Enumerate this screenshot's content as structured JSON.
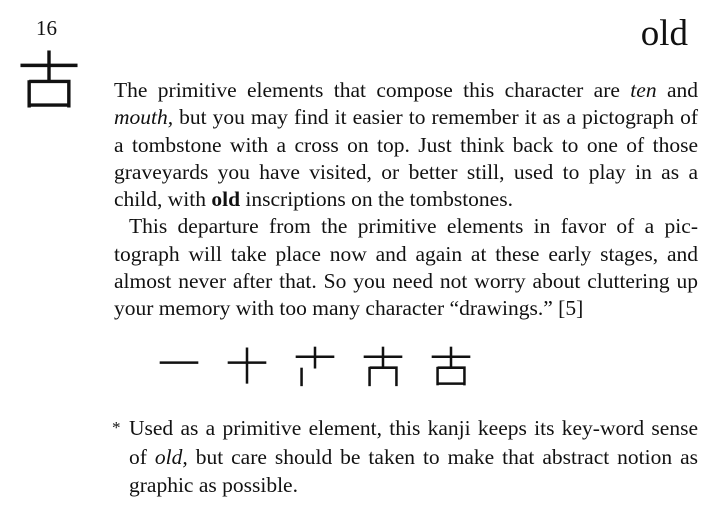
{
  "header": {
    "frame_number": "16",
    "keyword": "old",
    "kanji": "古"
  },
  "body": {
    "p1": {
      "t1": "The primitive elements that compose this character are ",
      "em_ten": "ten",
      "t2": " and ",
      "em_mouth": "mouth,",
      "t3": " but you may find it easier to remember it as a picto­graph of a tombstone with a cross on top. Just think back to one of those graveyards you have visited, or better still, used to play in as a child, with ",
      "strong_old": "old",
      "t4": " inscriptions on the tombstones."
    },
    "p2": {
      "text": "This departure from the primitive elements in favor of a pic­tograph will take place now and again at these early stages, and almost never after that. So you need not worry about clutter­ing up your memory with too many character “drawings.” [5]"
    }
  },
  "stroke_order": {
    "count": 5
  },
  "note": {
    "mark": "*",
    "t1": "Used as a primitive element, this kanji keeps its key-word sense of ",
    "em_old": "old,",
    "t2": " but care should be taken to make that abstract notion as graphic as possible."
  }
}
